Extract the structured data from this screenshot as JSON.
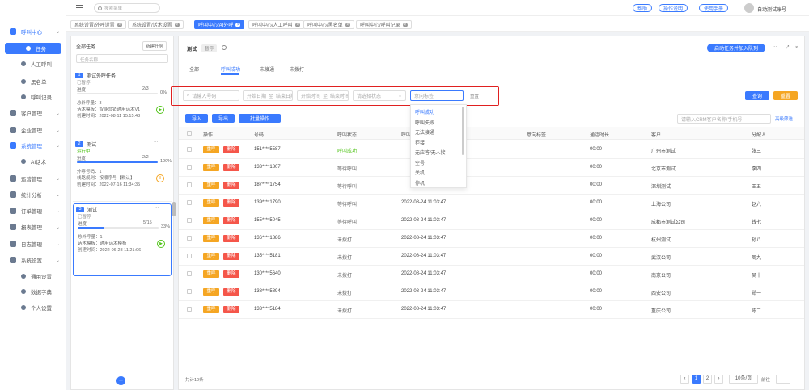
{
  "sidebar": {
    "items": [
      {
        "label": "呼叫中心",
        "type": "group-active"
      },
      {
        "label": "任务",
        "type": "active"
      },
      {
        "label": "人工呼叫",
        "type": "sub"
      },
      {
        "label": "黑名单",
        "type": "sub"
      },
      {
        "label": "呼叫记录",
        "type": "sub"
      },
      {
        "label": "客户管理",
        "type": "group"
      },
      {
        "label": "企业管理",
        "type": "group"
      },
      {
        "label": "系统管理",
        "type": "group-blue"
      },
      {
        "label": "AI话术",
        "type": "sub"
      },
      {
        "label": "运营管理",
        "type": "group"
      },
      {
        "label": "统计分析",
        "type": "group"
      },
      {
        "label": "订单管理",
        "type": "group"
      },
      {
        "label": "报表管理",
        "type": "group"
      },
      {
        "label": "日志管理",
        "type": "group"
      },
      {
        "label": "系统设置",
        "type": "group"
      },
      {
        "label": "通用设置",
        "type": "sub"
      },
      {
        "label": "数据字典",
        "type": "sub"
      },
      {
        "label": "个人设置",
        "type": "sub"
      }
    ]
  },
  "topbar": {
    "search_placeholder": "搜索菜单",
    "buttons": [
      "帮助",
      "操作说明",
      "使用手册"
    ],
    "user": "自动测试账号"
  },
  "tabs": [
    {
      "label": "系统设置/外呼设置"
    },
    {
      "label": "系统设置/话术设置"
    },
    {
      "label": "呼叫中心/AI外呼"
    },
    {
      "label": "呼叫中心/人工呼叫"
    },
    {
      "label": "呼叫中心/黑名单"
    },
    {
      "label": "呼叫中心/呼叫记录"
    }
  ],
  "taskpanel": {
    "title": "全部任务",
    "create_label": "新建任务",
    "search_placeholder": "任务名称",
    "add_icon": "+",
    "cards": [
      {
        "num": "1",
        "name": "测试外呼任务",
        "status": "已暂停",
        "progress_label": "进度",
        "progress_count": "2/3",
        "percent": "0%",
        "stat": "总外呼量：3",
        "line1": "话术模板：智能营销通用话术V1",
        "line2": "创建时间：2022-08-11 15:15:48",
        "progress": 0
      },
      {
        "num": "2",
        "name": "测试",
        "status": "运行中",
        "progress_label": "进度",
        "progress_count": "2/2",
        "percent": "100%",
        "stat": "外呼号码：1",
        "line1": "线路规则：按顺序号【默认】",
        "line2": "创建时间：2022-07-16 11:34:35",
        "progress": 1
      },
      {
        "num": "3",
        "name": "测试",
        "status": "已暂停",
        "progress_label": "进度",
        "progress_count": "5/15",
        "percent": "33%",
        "stat": "总外呼量：1",
        "line1": "话术模板：通用话术模板",
        "line2": "创建时间：2022-06-28 11:21:06",
        "progress": 0.33
      }
    ]
  },
  "main": {
    "title": "测试",
    "status_badge": "暂停",
    "top_btn": "启动任务并加入队列",
    "subtabs": [
      "全部",
      "呼叫成功",
      "未接通",
      "未拨打"
    ],
    "filters": {
      "phone": "请输入号码",
      "time_start": "开始日期",
      "time_sep": "至",
      "time_end": "结束日期",
      "call_start": "开始时间",
      "call_end": "结束时间",
      "status": "请选择状态",
      "intent": "意向标签",
      "search": "重置"
    },
    "filter_btns": {
      "query": "查询",
      "reset": "重置"
    },
    "dropdown": [
      "呼叫成功",
      "呼叫失败",
      "无法接通",
      "拒接",
      "无应答/无人接",
      "空号",
      "关机",
      "停机"
    ],
    "actions": {
      "import": "导入",
      "export": "导出",
      "batch": "批量操作",
      "search_placeholder": "请输入CRM客户名称/手机号",
      "advanced": "高级筛选"
    },
    "columns": [
      "操作",
      "号码",
      "呼叫状态",
      "呼叫时间",
      "意向标签",
      "通话时长",
      "客户",
      "分配人"
    ],
    "tag_labels": [
      "重呼",
      "删除"
    ],
    "rows": [
      {
        "phone": "151****5587",
        "status": "呼叫成功",
        "time": "",
        "duration": "00:00",
        "customer": "广州市测试",
        "owner": "张三"
      },
      {
        "phone": "133****1807",
        "status": "等待呼叫",
        "time": "",
        "duration": "00:00",
        "customer": "北京市测试",
        "owner": "李四"
      },
      {
        "phone": "187****1754",
        "status": "等待呼叫",
        "time": "",
        "duration": "00:00",
        "customer": "深圳测试",
        "owner": "王五"
      },
      {
        "phone": "139****1790",
        "status": "等待呼叫",
        "time": "2022-08-24 11:03:47",
        "duration": "00:00",
        "customer": "上海公司",
        "owner": "赵六"
      },
      {
        "phone": "155****5045",
        "status": "等待呼叫",
        "time": "2022-08-24 11:03:47",
        "duration": "00:00",
        "customer": "成都市测试公司",
        "owner": "钱七"
      },
      {
        "phone": "136****1886",
        "status": "未拨打",
        "time": "2022-08-24 11:03:47",
        "duration": "00:00",
        "customer": "杭州测试",
        "owner": "孙八"
      },
      {
        "phone": "135****5181",
        "status": "未拨打",
        "time": "2022-08-24 11:03:47",
        "duration": "00:00",
        "customer": "武汉公司",
        "owner": "周九"
      },
      {
        "phone": "130****5640",
        "status": "未拨打",
        "time": "2022-08-24 11:03:47",
        "duration": "00:00",
        "customer": "南京公司",
        "owner": "吴十"
      },
      {
        "phone": "138****5894",
        "status": "未拨打",
        "time": "2022-08-24 11:03:47",
        "duration": "00:00",
        "customer": "西安公司",
        "owner": "郑一"
      },
      {
        "phone": "133****5184",
        "status": "未拨打",
        "time": "2022-08-24 11:03:47",
        "duration": "00:00",
        "customer": "重庆公司",
        "owner": "陈二"
      }
    ],
    "pagination": {
      "total": "共计10条",
      "pages": [
        "1",
        "2"
      ],
      "size": "10条/页",
      "goto": "前往"
    }
  },
  "colors": {
    "primary": "#3a7afe",
    "orange": "#f5a623",
    "red": "#f5564a",
    "highlight": "#e02020"
  }
}
